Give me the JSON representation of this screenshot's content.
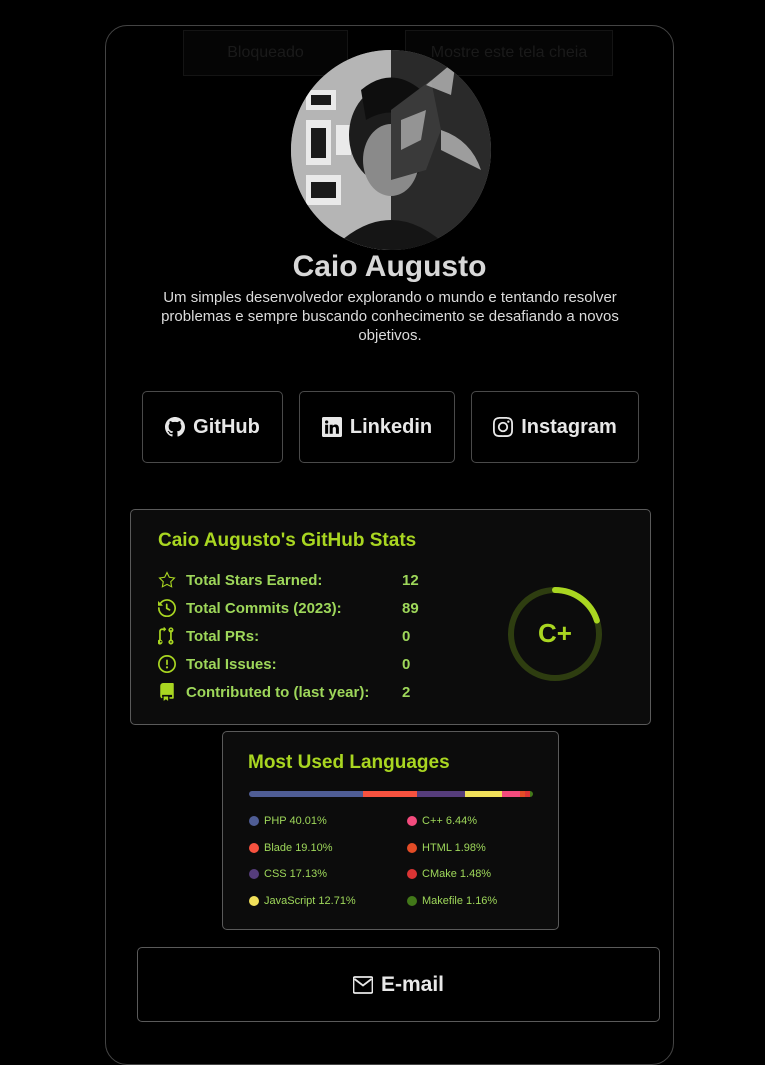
{
  "ghost_tabs": [
    "Bloqueado",
    "Mostre este tela cheia"
  ],
  "profile": {
    "name": "Caio Augusto",
    "bio": "Um simples desenvolvedor explorando o mundo e tentando resolver problemas e sempre buscando conhecimento se desafiando a novos objetivos."
  },
  "social": [
    {
      "label": "GitHub",
      "icon": "github-icon"
    },
    {
      "label": "Linkedin",
      "icon": "linkedin-icon"
    },
    {
      "label": "Instagram",
      "icon": "instagram-icon"
    }
  ],
  "github_stats": {
    "title": "Caio Augusto's GitHub Stats",
    "rows": [
      {
        "label": "Total Stars Earned:",
        "value": "12",
        "icon": "star-icon"
      },
      {
        "label": "Total Commits (2023):",
        "value": "89",
        "icon": "history-icon"
      },
      {
        "label": "Total PRs:",
        "value": "0",
        "icon": "pull-request-icon"
      },
      {
        "label": "Total Issues:",
        "value": "0",
        "icon": "issue-icon"
      },
      {
        "label": "Contributed to (last year):",
        "value": "2",
        "icon": "repo-icon"
      }
    ],
    "rank": "C+",
    "rank_progress": 0.2
  },
  "languages": {
    "title": "Most Used Languages",
    "items": [
      {
        "name": "PHP",
        "percent": "40.01%",
        "value": 40.01,
        "color": "#4F5D95"
      },
      {
        "name": "Blade",
        "percent": "19.10%",
        "value": 19.1,
        "color": "#f7523f"
      },
      {
        "name": "CSS",
        "percent": "17.13%",
        "value": 17.13,
        "color": "#563d7c"
      },
      {
        "name": "JavaScript",
        "percent": "12.71%",
        "value": 12.71,
        "color": "#f1e05a"
      },
      {
        "name": "C++",
        "percent": "6.44%",
        "value": 6.44,
        "color": "#f34b7d"
      },
      {
        "name": "HTML",
        "percent": "1.98%",
        "value": 1.98,
        "color": "#e34c26"
      },
      {
        "name": "CMake",
        "percent": "1.48%",
        "value": 1.48,
        "color": "#DA3434"
      },
      {
        "name": "Makefile",
        "percent": "1.16%",
        "value": 1.16,
        "color": "#427819"
      }
    ]
  },
  "email": {
    "label": "E-mail",
    "icon": "envelope-icon"
  },
  "colors": {
    "accent": "#a9d621",
    "text_green": "#9ed75a"
  }
}
